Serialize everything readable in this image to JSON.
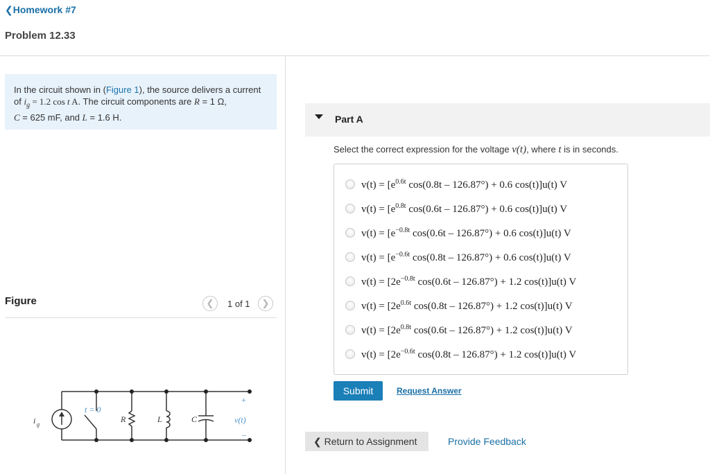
{
  "header": {
    "back_link": "Homework #7",
    "problem_title": "Problem 12.33"
  },
  "problem": {
    "text_1": "In the circuit shown in (",
    "figure_link": "Figure 1",
    "text_2": "), the source delivers a current",
    "text_3": "of ",
    "ig_sym": "i",
    "ig_sub": "g",
    "ig_expr": " = 1.2 cos ",
    "t_sym": "t",
    "ig_unit": " A",
    "text_4": ". The circuit components are ",
    "R_sym": "R",
    "R_val": " = 1 Ω,",
    "C_sym": "C",
    "C_val": " = 625 mF",
    "text_5": ", and ",
    "L_sym": "L",
    "L_val": " = 1.6 H."
  },
  "figure": {
    "label": "Figure",
    "pager_text": "1 of 1",
    "prev_icon": "chevron-left",
    "next_icon": "chevron-right",
    "circuit_labels": {
      "ig": "i",
      "ig_sub": "g",
      "switch": "t = 0",
      "R": "R",
      "L": "L",
      "C": "C",
      "v": "v(t)",
      "plus": "+",
      "minus": "–"
    }
  },
  "part": {
    "title": "Part A",
    "question_1": "Select the correct expression for the voltage ",
    "question_v": "v(t)",
    "question_2": ", where ",
    "question_t": "t",
    "question_3": " is in seconds."
  },
  "options": [
    {
      "pre": "v(t) = [e",
      "exp": "0.6t",
      "post": " cos(0.8t – 126.87°) + 0.6 cos(t)]u(t) V"
    },
    {
      "pre": "v(t) = [e",
      "exp": "0.8t",
      "post": " cos(0.6t – 126.87°) + 0.6 cos(t)]u(t) V"
    },
    {
      "pre": "v(t) = [e",
      "exp": "−0.8t",
      "post": " cos(0.6t – 126.87°) + 0.6 cos(t)]u(t) V"
    },
    {
      "pre": "v(t) = [e",
      "exp": "−0.6t",
      "post": " cos(0.8t – 126.87°) + 0.6 cos(t)]u(t) V"
    },
    {
      "pre": "v(t) = [2e",
      "exp": "−0.8t",
      "post": " cos(0.6t – 126.87°) + 1.2 cos(t)]u(t) V"
    },
    {
      "pre": "v(t) = [2e",
      "exp": "0.6t",
      "post": " cos(0.8t – 126.87°) + 1.2 cos(t)]u(t) V"
    },
    {
      "pre": "v(t) = [2e",
      "exp": "0.8t",
      "post": " cos(0.6t – 126.87°) + 1.2 cos(t)]u(t) V"
    },
    {
      "pre": "v(t) = [2e",
      "exp": "−0.6t",
      "post": " cos(0.8t – 126.87°) + 1.2 cos(t)]u(t) V"
    }
  ],
  "actions": {
    "submit": "Submit",
    "request_answer": "Request Answer",
    "return": "Return to Assignment",
    "feedback": "Provide Feedback"
  },
  "colors": {
    "link": "#1a6fa6",
    "button": "#1b7fb8",
    "problem_bg": "#e8f2fb"
  }
}
